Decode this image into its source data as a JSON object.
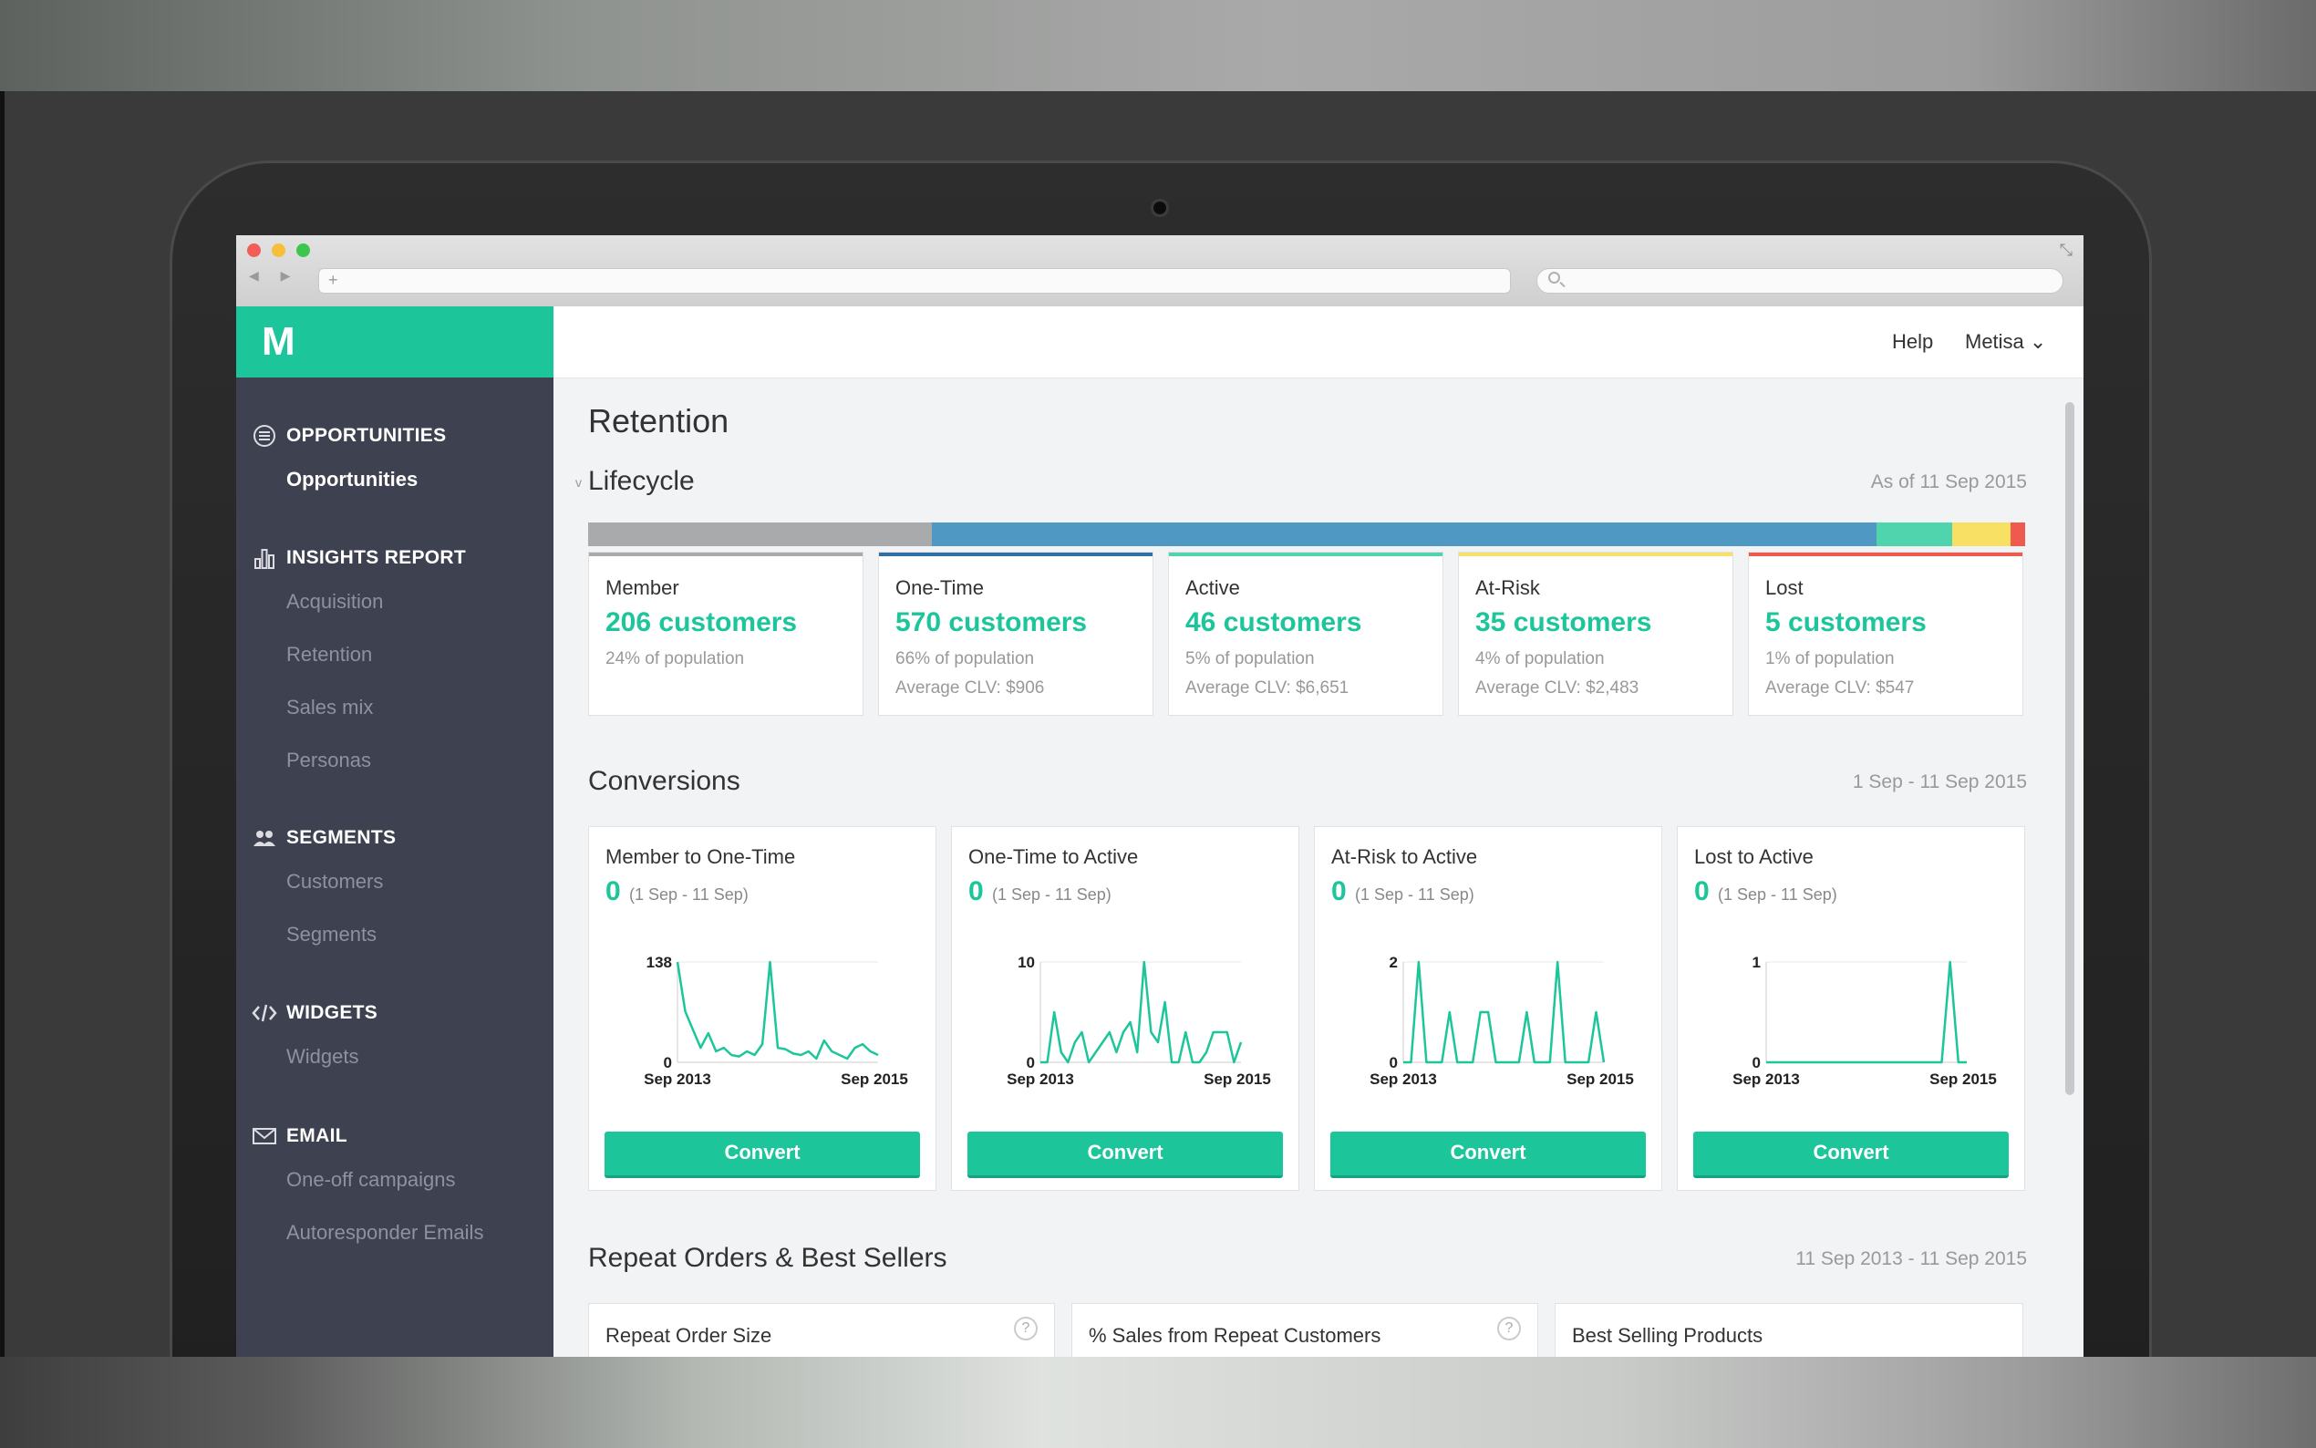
{
  "browser": {
    "url_plus": "+",
    "nav_arrows": "◀ ▶"
  },
  "app": {
    "logo": "M"
  },
  "header": {
    "help_label": "Help",
    "user_label": "Metisa",
    "user_caret": "⌄"
  },
  "sidebar": {
    "sections": [
      {
        "title": "OPPORTUNITIES",
        "icon": "list-icon",
        "items": [
          "Opportunities"
        ],
        "active": "Opportunities"
      },
      {
        "title": "INSIGHTS REPORT",
        "icon": "bar-chart-icon",
        "items": [
          "Acquisition",
          "Retention",
          "Sales mix",
          "Personas"
        ]
      },
      {
        "title": "SEGMENTS",
        "icon": "users-icon",
        "items": [
          "Customers",
          "Segments"
        ]
      },
      {
        "title": "WIDGETS",
        "icon": "code-icon",
        "items": [
          "Widgets"
        ]
      },
      {
        "title": "EMAIL",
        "icon": "envelope-icon",
        "items": [
          "One-off campaigns",
          "Autoresponder Emails"
        ]
      }
    ]
  },
  "main": {
    "title": "Retention",
    "lifecycle": {
      "heading": "Lifecycle",
      "caret": "v",
      "as_of": "As of 11 Sep 2015",
      "bar_colors": [
        "#a9aaab",
        "#4f98c3",
        "#4fd4ae",
        "#f7e064",
        "#ef5a4f"
      ],
      "bar_shares": [
        0.24,
        0.66,
        0.053,
        0.041,
        0.01
      ],
      "cards": [
        {
          "name": "Member",
          "count": "206 customers",
          "pct": "24% of population",
          "clv": "",
          "color": "#a9aaab"
        },
        {
          "name": "One-Time",
          "count": "570 customers",
          "pct": "66% of population",
          "clv": "Average CLV: $906",
          "color": "#2f6fa6"
        },
        {
          "name": "Active",
          "count": "46 customers",
          "pct": "5% of population",
          "clv": "Average CLV: $6,651",
          "color": "#4fd4ae"
        },
        {
          "name": "At-Risk",
          "count": "35 customers",
          "pct": "4% of population",
          "clv": "Average CLV: $2,483",
          "color": "#f7e064"
        },
        {
          "name": "Lost",
          "count": "5 customers",
          "pct": "1% of population",
          "clv": "Average CLV: $547",
          "color": "#ef5a4f"
        }
      ]
    },
    "conversions": {
      "heading": "Conversions",
      "range": "1 Sep - 11 Sep 2015",
      "button_label": "Convert",
      "cards": [
        {
          "title": "Member to One-Time",
          "value": "0",
          "range": "(1 Sep - 11 Sep)",
          "ymax_label": "138",
          "ymin_label": "0",
          "x_start": "Sep 2013",
          "x_end": "Sep 2015"
        },
        {
          "title": "One-Time to Active",
          "value": "0",
          "range": "(1 Sep - 11 Sep)",
          "ymax_label": "10",
          "ymin_label": "0",
          "x_start": "Sep 2013",
          "x_end": "Sep 2015"
        },
        {
          "title": "At-Risk to Active",
          "value": "0",
          "range": "(1 Sep - 11 Sep)",
          "ymax_label": "2",
          "ymin_label": "0",
          "x_start": "Sep 2013",
          "x_end": "Sep 2015"
        },
        {
          "title": "Lost to Active",
          "value": "0",
          "range": "(1 Sep - 11 Sep)",
          "ymax_label": "1",
          "ymin_label": "0",
          "x_start": "Sep 2013",
          "x_end": "Sep 2015"
        }
      ]
    },
    "repeat": {
      "heading": "Repeat Orders & Best Sellers",
      "range": "11 Sep 2013 - 11 Sep 2015",
      "help_glyph": "?",
      "cards": [
        {
          "title": "Repeat Order Size",
          "help": true
        },
        {
          "title": "% Sales from Repeat Customers",
          "help": true
        },
        {
          "title": "Best Selling Products",
          "help": false
        }
      ]
    }
  },
  "chart_data": [
    {
      "type": "line",
      "title": "Member to One-Time",
      "ylim": [
        0,
        138
      ],
      "x_range": [
        "Sep 2013",
        "Sep 2015"
      ],
      "series": [
        {
          "values": [
            138,
            70,
            45,
            20,
            40,
            15,
            20,
            10,
            8,
            15,
            10,
            25,
            138,
            20,
            18,
            12,
            10,
            15,
            5,
            30,
            15,
            10,
            5,
            20,
            25,
            15,
            10
          ]
        }
      ]
    },
    {
      "type": "line",
      "title": "One-Time to Active",
      "ylim": [
        0,
        10
      ],
      "x_range": [
        "Sep 2013",
        "Sep 2015"
      ],
      "series": [
        {
          "values": [
            0,
            0,
            5,
            1,
            0,
            2,
            3,
            0,
            1,
            2,
            3,
            1,
            3,
            4,
            1,
            10,
            3,
            2,
            6,
            0,
            0,
            3,
            0,
            0,
            1,
            3,
            3,
            3,
            0,
            2
          ]
        }
      ]
    },
    {
      "type": "line",
      "title": "At-Risk to Active",
      "ylim": [
        0,
        2
      ],
      "x_range": [
        "Sep 2013",
        "Sep 2015"
      ],
      "series": [
        {
          "values": [
            0,
            0,
            2,
            0,
            0,
            0,
            1,
            0,
            0,
            0,
            1,
            1,
            0,
            0,
            0,
            0,
            1,
            0,
            0,
            0,
            2,
            0,
            0,
            0,
            0,
            1,
            0
          ]
        }
      ]
    },
    {
      "type": "line",
      "title": "Lost to Active",
      "ylim": [
        0,
        1
      ],
      "x_range": [
        "Sep 2013",
        "Sep 2015"
      ],
      "series": [
        {
          "values": [
            0,
            0,
            0,
            0,
            0,
            0,
            0,
            0,
            0,
            0,
            0,
            0,
            0,
            0,
            0,
            0,
            0,
            0,
            0,
            0,
            0,
            0,
            1,
            0,
            0
          ]
        }
      ]
    }
  ]
}
